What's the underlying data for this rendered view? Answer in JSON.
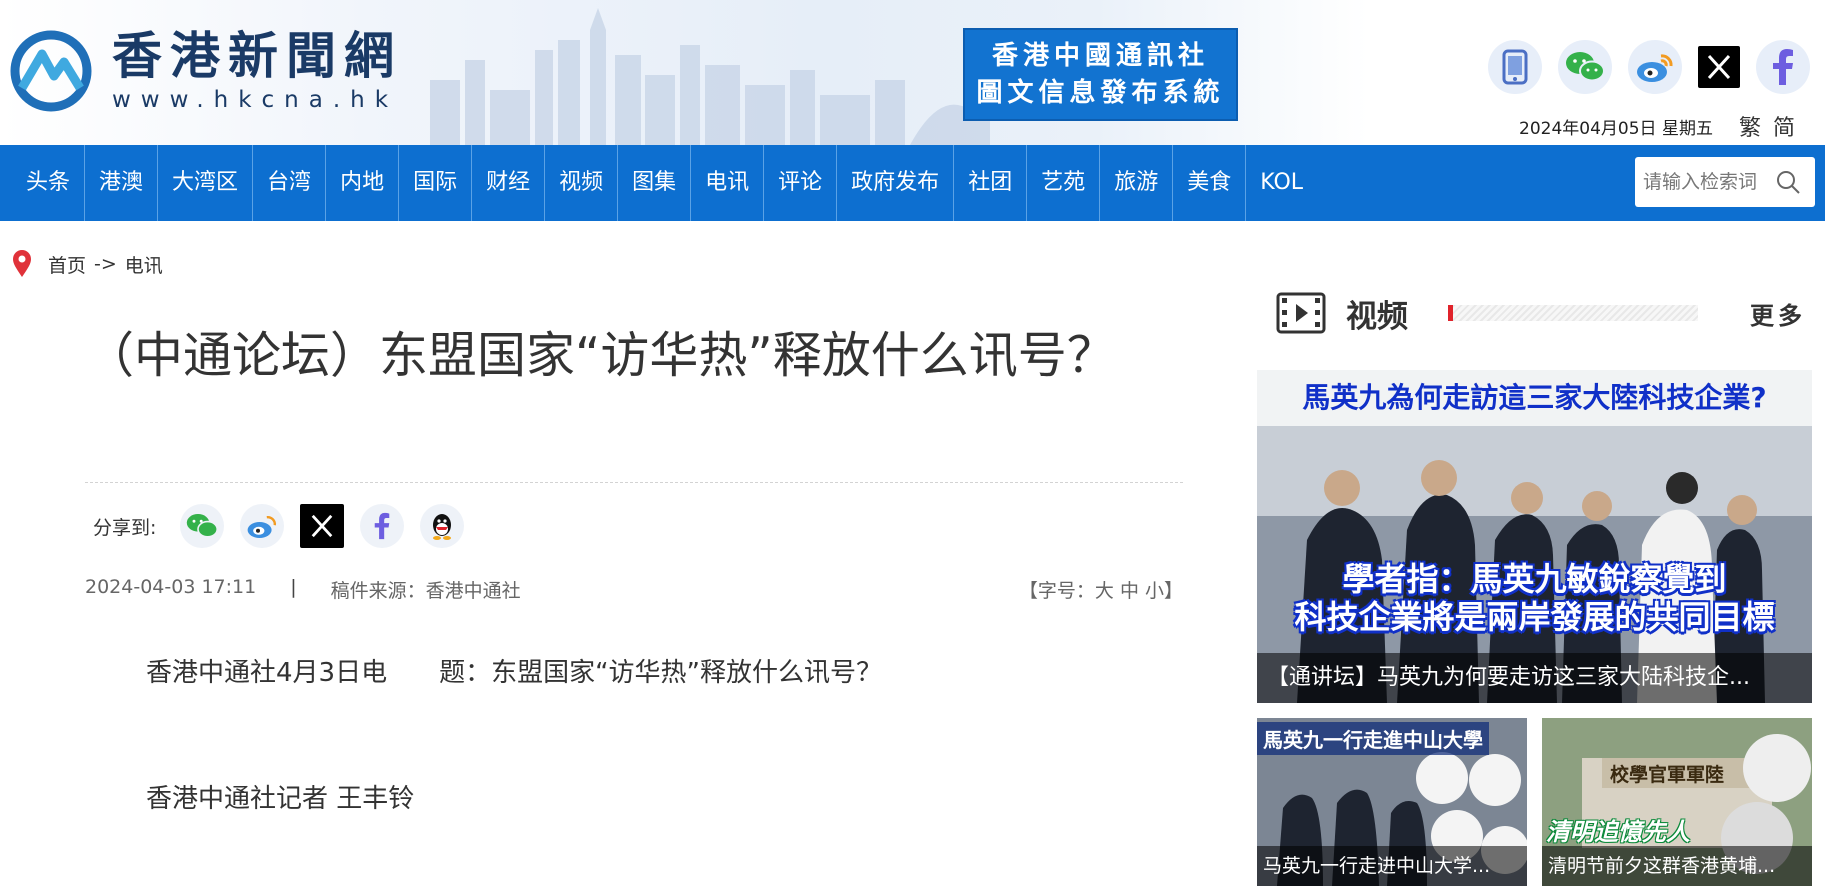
{
  "site": {
    "logo_name": "香港新聞網",
    "logo_url": "www.hkcna.hk",
    "agency_line1": "香港中國通訊社",
    "agency_line2": "圖文信息發布系統",
    "date": "2024年04月05日 星期五",
    "lang_trad": "繁",
    "lang_simp": "简",
    "social": [
      "mobile-icon",
      "wechat-icon",
      "weibo-icon",
      "x-icon",
      "facebook-icon"
    ]
  },
  "nav": {
    "items": [
      "头条",
      "港澳",
      "大湾区",
      "台湾",
      "内地",
      "国际",
      "财经",
      "视频",
      "图集",
      "电讯",
      "评论",
      "政府发布",
      "社团",
      "艺苑",
      "旅游",
      "美食",
      "KOL"
    ],
    "search_placeholder": "请输入检索词"
  },
  "breadcrumb": {
    "home": "首页",
    "sep": "->",
    "current": "电讯"
  },
  "article": {
    "title": "（中通论坛）东盟国家“访华热”释放什么讯号？",
    "share_label": "分享到:",
    "share_icons": [
      "wechat-icon",
      "weibo-icon",
      "x-icon",
      "facebook-icon",
      "qq-icon"
    ],
    "datetime": "2024-04-03 17:11",
    "source_label": "稿件来源：香港中通社",
    "font_size_label": "【字号：大 中 小】",
    "para1": "香港中通社4月3日电　　题：东盟国家“访华热”释放什么讯号？",
    "para2": "香港中通社记者 王丰铃"
  },
  "sidebar": {
    "title": "视频",
    "more": "更多",
    "main_video": {
      "banner_top": "馬英九為何走訪這三家大陸科技企業?",
      "banner_mid_1": "學者指：馬英九敏銳察覺到",
      "banner_mid_2": "科技企業將是兩岸發展的共同目標",
      "caption": "【通讲坛】马英九为何要走访这三家大陆科技企..."
    },
    "small_videos": [
      {
        "banner": "馬英九一行走進中山大學",
        "caption": "马英九一行走进中山大学...",
        "tag": ""
      },
      {
        "banner": "校學官軍軍陸",
        "caption": "清明节前夕这群香港黄埔...",
        "tag": "清明追憶先人"
      }
    ]
  },
  "colors": {
    "nav_bg": "#0d6fd0",
    "agency_box": "#1273d0",
    "accent_red": "#e0232b",
    "logo_navy": "#1a3a66"
  }
}
